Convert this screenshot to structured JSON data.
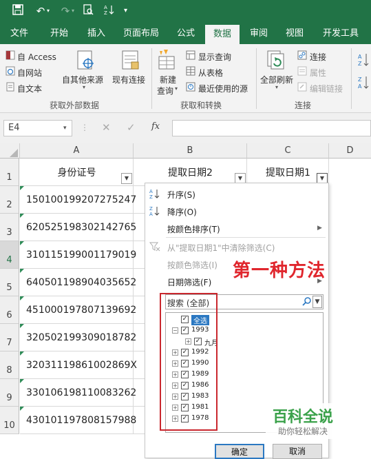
{
  "qat": {
    "undo_glyph": "↶",
    "redo_glyph": "↷",
    "more_glyph": "▾"
  },
  "tabs": [
    "文件",
    "开始",
    "插入",
    "页面布局",
    "公式",
    "数据",
    "审阅",
    "视图",
    "开发工具"
  ],
  "active_tab": "数据",
  "ribbon": {
    "get_external": {
      "access": "自 Access",
      "web": "自网站",
      "text": "自文本",
      "other_sources": "自其他来源",
      "existing": "现有连接",
      "group_label": "获取外部数据"
    },
    "get_transform": {
      "new_query_line1": "新建",
      "new_query_line2": "查询",
      "show_queries": "显示查询",
      "from_table": "从表格",
      "recent_sources": "最近使用的源",
      "group_label": "获取和转换"
    },
    "connections": {
      "refresh_all": "全部刷新",
      "connections": "连接",
      "properties": "属性",
      "edit_links": "编辑链接",
      "group_label": "连接"
    }
  },
  "formula_bar": {
    "name_box": "E4",
    "cancel_glyph": "✕",
    "enter_glyph": "✓",
    "fx_glyph": "fx",
    "formula": ""
  },
  "columns": [
    "A",
    "B",
    "C",
    "D"
  ],
  "rows": [
    "1",
    "2",
    "3",
    "4",
    "5",
    "6",
    "7",
    "8",
    "9",
    "10"
  ],
  "headers": {
    "a": "身份证号",
    "b": "提取日期2",
    "c": "提取日期1"
  },
  "id_numbers": [
    "150100199207275247",
    "620525198302142765",
    "310115199001179019",
    "640501198904035652",
    "451000197807139692",
    "320502199309018782",
    "32031119861002869X",
    "330106198110083262",
    "430101197808157988"
  ],
  "filter_menu": {
    "sort_asc": "升序(S)",
    "sort_desc": "降序(O)",
    "sort_by_color": "按颜色排序(T)",
    "clear_filter": "从\"提取日期1\"中清除筛选(C)",
    "color_filter": "按颜色筛选(I)",
    "date_filter": "日期筛选(F)",
    "search_placeholder": "搜索 (全部)",
    "select_all": "全选",
    "years": [
      "1993",
      "1992",
      "1990",
      "1989",
      "1986",
      "1983",
      "1981",
      "1978"
    ],
    "sub_month": "九月",
    "ok": "确定",
    "cancel": "取消"
  },
  "annotation": "第一种方法",
  "watermark": {
    "title": "百科全说",
    "subtitle": "助你轻松解决"
  },
  "colors": {
    "excel_green": "#217346",
    "annotation_red": "#e0262d",
    "highlight_box": "#c9262d",
    "watermark_green": "#3aa14a"
  }
}
